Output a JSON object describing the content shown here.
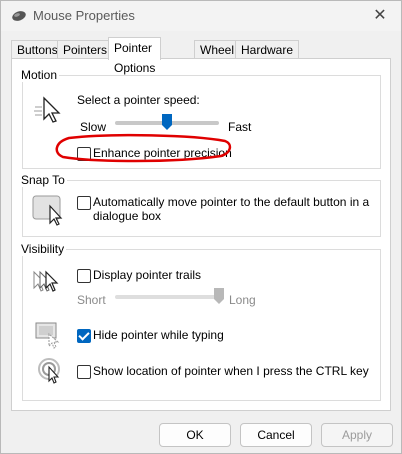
{
  "window": {
    "title": "Mouse Properties",
    "close_glyph": "✕"
  },
  "tabs": [
    "Buttons",
    "Pointers",
    "Pointer Options",
    "Wheel",
    "Hardware"
  ],
  "motion": {
    "group_label": "Motion",
    "speed_label": "Select a pointer speed:",
    "slow_label": "Slow",
    "fast_label": "Fast",
    "speed_value": 0.5,
    "enhance_label": "Enhance pointer precision",
    "enhance_checked": false
  },
  "snap_to": {
    "group_label": "Snap To",
    "label_line1": "Automatically move pointer to the default button in a",
    "label_line2": "dialogue box",
    "checked": false
  },
  "visibility": {
    "group_label": "Visibility",
    "trails_label": "Display pointer trails",
    "trails_checked": false,
    "short_label": "Short",
    "long_label": "Long",
    "trail_value": 1.0,
    "hide_label": "Hide pointer while typing",
    "hide_checked": true,
    "show_location_label": "Show location of pointer when I press the CTRL key",
    "show_location_checked": false
  },
  "buttons": {
    "ok": "OK",
    "cancel": "Cancel",
    "apply": "Apply"
  },
  "colors": {
    "accent": "#0067c0",
    "annotation": "#e00000"
  },
  "icons": [
    "mouse-icon",
    "close-icon",
    "pointer-speed-icon",
    "snap-to-icon",
    "pointer-trails-icon",
    "hide-pointer-icon",
    "show-location-icon"
  ]
}
